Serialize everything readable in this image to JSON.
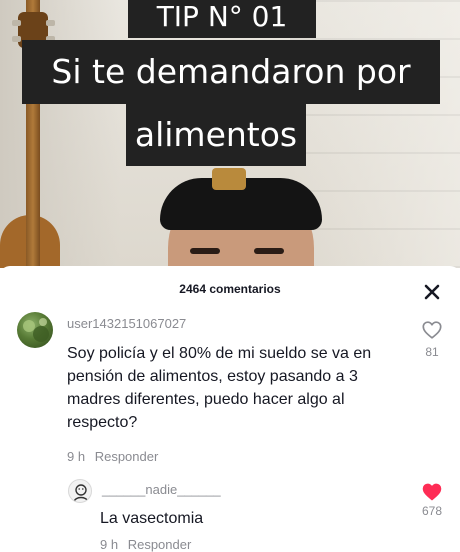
{
  "video": {
    "captions": [
      "TIP N° 01",
      "Si te demandaron por",
      "alimentos"
    ]
  },
  "comments_panel": {
    "count_label": "2464 comentarios",
    "close_icon": "close-icon"
  },
  "comment": {
    "username": "user1432151067027",
    "text": "Soy policía y el 80% de mi sueldo se va en pensión de alimentos, estoy pasando a 3 madres diferentes, puedo hacer algo al respecto?",
    "time": "9 h",
    "reply_label": "Responder",
    "like_count": "81",
    "liked": false
  },
  "reply": {
    "username": "______nadie______",
    "text": "La vasectomia",
    "time": "9 h",
    "reply_label": "Responder",
    "like_count": "678",
    "liked": true
  },
  "colors": {
    "caption_bg": "#222222",
    "text_primary": "#161823",
    "text_secondary": "#8a8b91",
    "liked_heart": "#fe2c55"
  }
}
